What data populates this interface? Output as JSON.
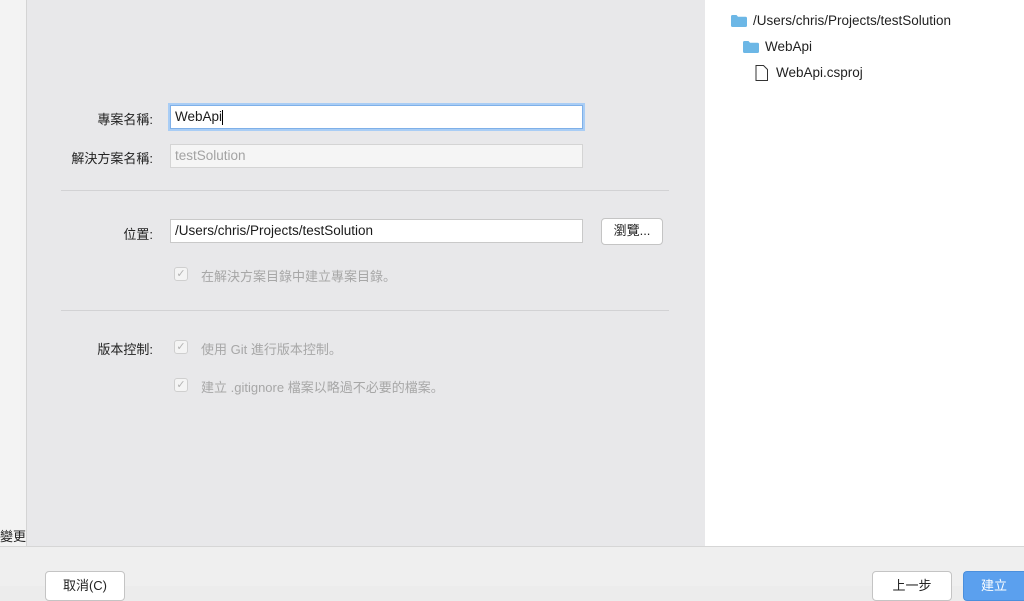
{
  "left_strip": {
    "label": "變更"
  },
  "form": {
    "project_name": {
      "label": "專案名稱:",
      "value": "WebApi"
    },
    "solution_name": {
      "label": "解決方案名稱:",
      "value": "testSolution"
    },
    "location": {
      "label": "位置:",
      "value": "/Users/chris/Projects/testSolution",
      "browse_label": "瀏覽..."
    },
    "create_dir_checkbox": {
      "label": "在解決方案目錄中建立專案目錄。",
      "checked": true
    },
    "version_control": {
      "label": "版本控制:",
      "use_git": {
        "label": "使用 Git 進行版本控制。",
        "checked": true
      },
      "gitignore": {
        "label": "建立 .gitignore 檔案以略過不必要的檔案。",
        "checked": true
      }
    }
  },
  "tree": {
    "items": [
      {
        "label": "/Users/chris/Projects/testSolution",
        "icon": "folder-icon"
      },
      {
        "label": "WebApi",
        "icon": "folder-icon"
      },
      {
        "label": "WebApi.csproj",
        "icon": "file-icon"
      }
    ]
  },
  "bottom": {
    "cancel_label": "取消(C)",
    "previous_label": "上一步",
    "create_label": "建立"
  },
  "colors": {
    "accent": "#5ba0ee",
    "folder": "#6cb7e6",
    "focus_ring": "#a9cdf5"
  }
}
